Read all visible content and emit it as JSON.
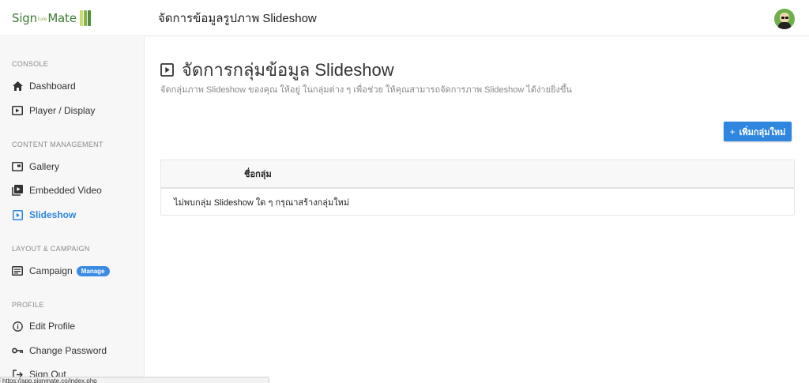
{
  "header": {
    "logo_text_left": "Sign",
    "logo_text_mini": "ture",
    "logo_text_right": "Mate",
    "title": "จัดการข้อมูลรูปภาพ Slideshow"
  },
  "sidebar": {
    "sections": [
      {
        "title": "CONSOLE",
        "items": [
          {
            "label": "Dashboard",
            "icon": "home-icon"
          },
          {
            "label": "Player / Display",
            "icon": "play-box-icon"
          }
        ]
      },
      {
        "title": "CONTENT MANAGEMENT",
        "items": [
          {
            "label": "Gallery",
            "icon": "gallery-icon"
          },
          {
            "label": "Embedded Video",
            "icon": "video-library-icon"
          },
          {
            "label": "Slideshow",
            "icon": "slideshow-icon",
            "active": true
          }
        ]
      },
      {
        "title": "LAYOUT & CAMPAIGN",
        "items": [
          {
            "label": "Campaign",
            "icon": "list-icon",
            "badge": "Manage"
          }
        ]
      },
      {
        "title": "PROFILE",
        "items": [
          {
            "label": "Edit Profile",
            "icon": "info-icon"
          },
          {
            "label": "Change Password",
            "icon": "key-icon"
          },
          {
            "label": "Sign Out",
            "icon": "exit-icon"
          }
        ]
      }
    ]
  },
  "main": {
    "title": "จัดการกลุ่มข้อมูล Slideshow",
    "description": "จัดกลุ่มภาพ Slideshow ของคุณ ให้อยู่ ในกลุ่มต่าง ๆ เพื่อช่วย ให้คุณสามารถจัดการภาพ Slideshow ได้ง่ายยิ่งขึ้น",
    "add_button": "เพิ่มกลุ่มใหม่",
    "table": {
      "columns": [
        "ชื่อกลุ่ม"
      ],
      "empty_message": "ไม่พบกลุ่ม Slideshow ใด ๆ กรุณาสร้างกลุ่มใหม่"
    }
  },
  "statusbar": {
    "url": "https://app.signmate.co/index.php"
  },
  "colors": {
    "accent": "#2f86de",
    "sidebar_bg": "#f7f7f7",
    "logo_green": "#3c7a34"
  }
}
